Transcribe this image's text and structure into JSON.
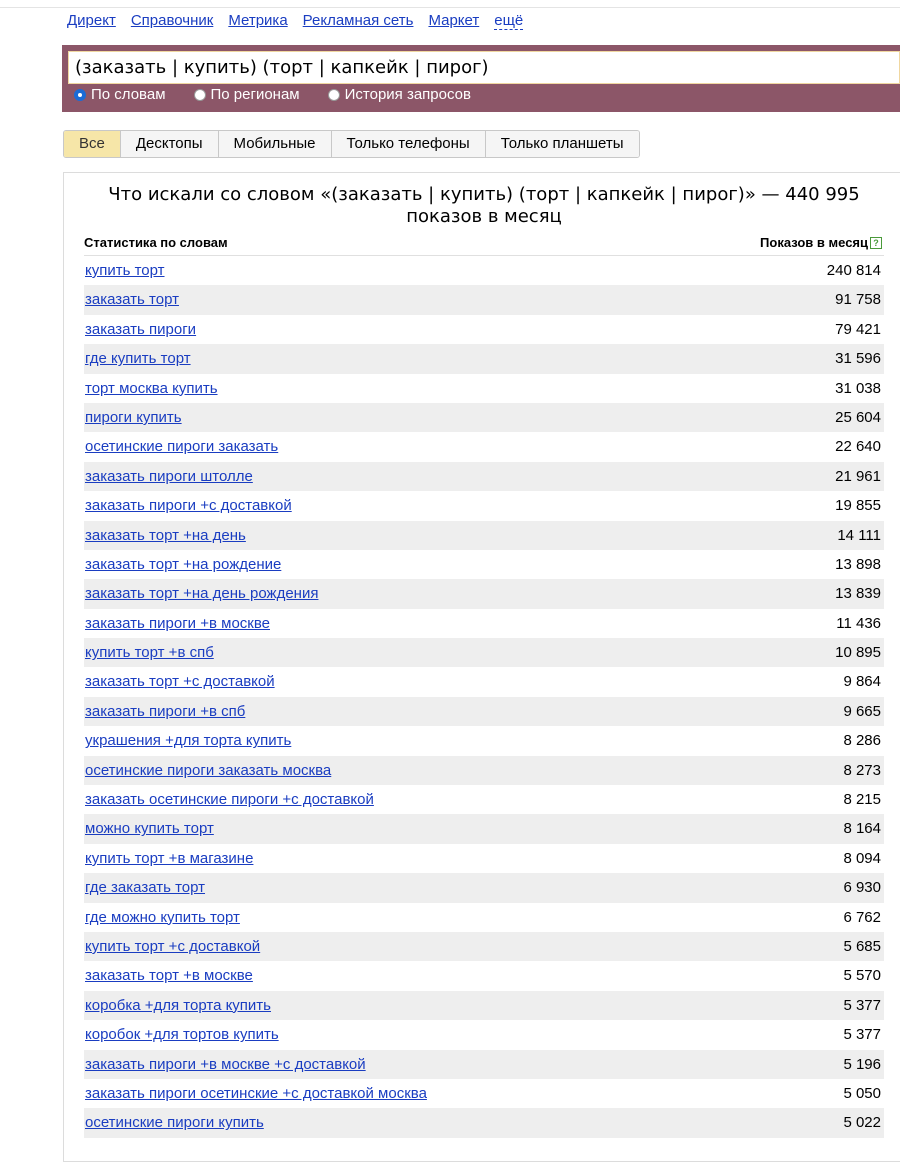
{
  "services": [
    "Директ",
    "Справочник",
    "Метрика",
    "Рекламная сеть",
    "Маркет"
  ],
  "services_more": "ещё",
  "search": {
    "query": "(заказать | купить) (торт | капкейк | пирог)",
    "radios": [
      {
        "label": "По словам",
        "selected": true
      },
      {
        "label": "По регионам",
        "selected": false
      },
      {
        "label": "История запросов",
        "selected": false
      }
    ]
  },
  "tabs": [
    {
      "label": "Все",
      "active": true
    },
    {
      "label": "Десктопы",
      "active": false
    },
    {
      "label": "Мобильные",
      "active": false
    },
    {
      "label": "Только телефоны",
      "active": false
    },
    {
      "label": "Только планшеты",
      "active": false
    }
  ],
  "results": {
    "title": "Что искали со словом «(заказать | купить) (торт | капкейк | пирог)» — 440 995 показов в месяц",
    "col_left": "Статистика по словам",
    "col_right": "Показов в месяц",
    "hint_icon": "question-icon",
    "hint_glyph": "?",
    "rows": [
      {
        "phrase": "купить торт",
        "count": "240 814"
      },
      {
        "phrase": "заказать торт",
        "count": "91 758"
      },
      {
        "phrase": "заказать пироги",
        "count": "79 421"
      },
      {
        "phrase": "где купить торт",
        "count": "31 596"
      },
      {
        "phrase": "торт москва купить",
        "count": "31 038"
      },
      {
        "phrase": "пироги купить",
        "count": "25 604"
      },
      {
        "phrase": "осетинские пироги заказать",
        "count": "22 640"
      },
      {
        "phrase": "заказать пироги штолле",
        "count": "21 961"
      },
      {
        "phrase": "заказать пироги +с доставкой",
        "count": "19 855"
      },
      {
        "phrase": "заказать торт +на день",
        "count": "14 111"
      },
      {
        "phrase": "заказать торт +на рождение",
        "count": "13 898"
      },
      {
        "phrase": "заказать торт +на день рождения",
        "count": "13 839"
      },
      {
        "phrase": "заказать пироги +в москве",
        "count": "11 436"
      },
      {
        "phrase": "купить торт +в спб",
        "count": "10 895"
      },
      {
        "phrase": "заказать торт +с доставкой",
        "count": "9 864"
      },
      {
        "phrase": "заказать пироги +в спб",
        "count": "9 665"
      },
      {
        "phrase": "украшения +для торта купить",
        "count": "8 286"
      },
      {
        "phrase": "осетинские пироги заказать москва",
        "count": "8 273"
      },
      {
        "phrase": "заказать осетинские пироги +с доставкой",
        "count": "8 215"
      },
      {
        "phrase": "можно купить торт",
        "count": "8 164"
      },
      {
        "phrase": "купить торт +в магазине",
        "count": "8 094"
      },
      {
        "phrase": "где заказать торт",
        "count": "6 930"
      },
      {
        "phrase": "где можно купить торт",
        "count": "6 762"
      },
      {
        "phrase": "купить торт +с доставкой",
        "count": "5 685"
      },
      {
        "phrase": "заказать торт +в москве",
        "count": "5 570"
      },
      {
        "phrase": "коробка +для торта купить",
        "count": "5 377"
      },
      {
        "phrase": "коробок +для тортов купить",
        "count": "5 377"
      },
      {
        "phrase": "заказать пироги +в москве +с доставкой",
        "count": "5 196"
      },
      {
        "phrase": "заказать пироги осетинские +с доставкой москва",
        "count": "5 050"
      },
      {
        "phrase": "осетинские пироги купить",
        "count": "5 022"
      }
    ]
  }
}
